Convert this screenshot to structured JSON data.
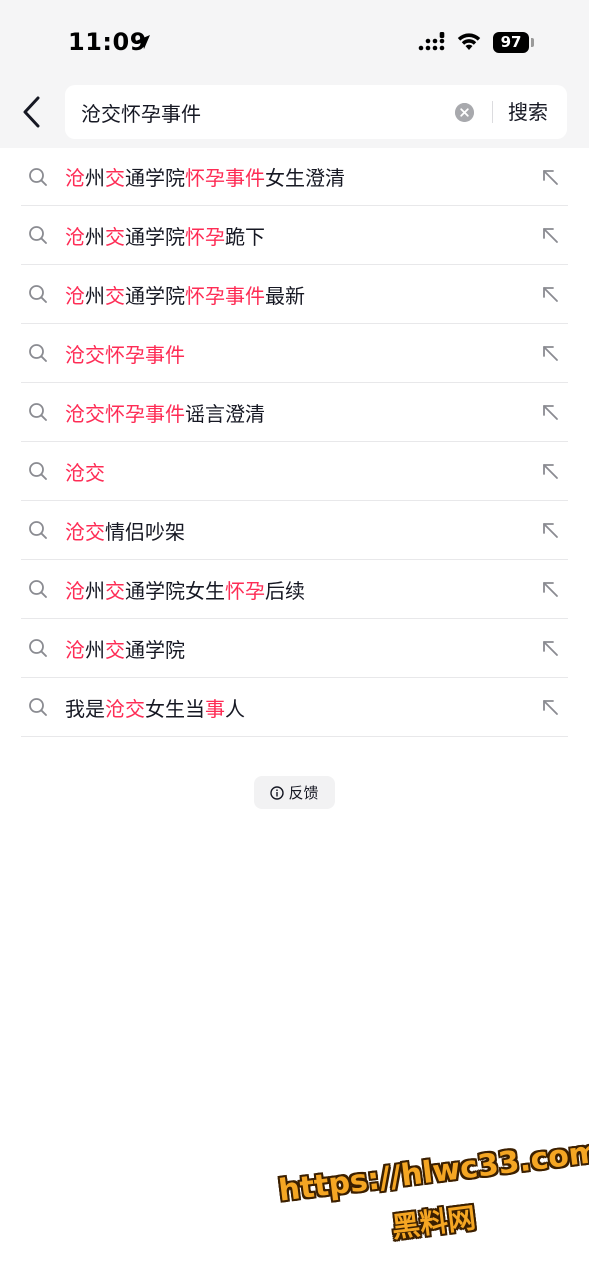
{
  "status_bar": {
    "time": "11:09",
    "battery": "97",
    "location_icon": "location-arrow-icon",
    "signal_icon": "cellular-signal-icon",
    "wifi_icon": "wifi-icon"
  },
  "search": {
    "query": "沧交怀孕事件",
    "button_label": "搜索",
    "back_icon": "chevron-left-icon",
    "clear_icon": "clear-circle-icon"
  },
  "suggestions": [
    {
      "segments": [
        {
          "t": "沧",
          "h": true
        },
        {
          "t": "州",
          "h": false
        },
        {
          "t": "交",
          "h": true
        },
        {
          "t": "通学院",
          "h": false
        },
        {
          "t": "怀孕事件",
          "h": true
        },
        {
          "t": "女生澄清",
          "h": false
        }
      ]
    },
    {
      "segments": [
        {
          "t": "沧",
          "h": true
        },
        {
          "t": "州",
          "h": false
        },
        {
          "t": "交",
          "h": true
        },
        {
          "t": "通学院",
          "h": false
        },
        {
          "t": "怀孕",
          "h": true
        },
        {
          "t": "跪下",
          "h": false
        }
      ]
    },
    {
      "segments": [
        {
          "t": "沧",
          "h": true
        },
        {
          "t": "州",
          "h": false
        },
        {
          "t": "交",
          "h": true
        },
        {
          "t": "通学院",
          "h": false
        },
        {
          "t": "怀孕事件",
          "h": true
        },
        {
          "t": "最新",
          "h": false
        }
      ]
    },
    {
      "segments": [
        {
          "t": "沧交怀孕事件",
          "h": true
        }
      ]
    },
    {
      "segments": [
        {
          "t": "沧交怀孕事件",
          "h": true
        },
        {
          "t": "谣言澄清",
          "h": false
        }
      ]
    },
    {
      "segments": [
        {
          "t": "沧交",
          "h": true
        }
      ]
    },
    {
      "segments": [
        {
          "t": "沧交",
          "h": true
        },
        {
          "t": "情侣吵架",
          "h": false
        }
      ]
    },
    {
      "segments": [
        {
          "t": "沧",
          "h": true
        },
        {
          "t": "州",
          "h": false
        },
        {
          "t": "交",
          "h": true
        },
        {
          "t": "通学院女生",
          "h": false
        },
        {
          "t": "怀孕",
          "h": true
        },
        {
          "t": "后续",
          "h": false
        }
      ]
    },
    {
      "segments": [
        {
          "t": "沧",
          "h": true
        },
        {
          "t": "州",
          "h": false
        },
        {
          "t": "交",
          "h": true
        },
        {
          "t": "通学院",
          "h": false
        }
      ]
    },
    {
      "segments": [
        {
          "t": "我是",
          "h": false
        },
        {
          "t": "沧交",
          "h": true
        },
        {
          "t": "女生当",
          "h": false
        },
        {
          "t": "事",
          "h": true
        },
        {
          "t": "人",
          "h": false
        }
      ]
    }
  ],
  "suggestion_icons": {
    "left": "search-icon",
    "right": "fill-query-arrow-icon"
  },
  "feedback": {
    "label": "反馈",
    "icon": "info-icon"
  },
  "watermark": {
    "url": "https://hlwc33.com",
    "name": "黑料网"
  },
  "colors": {
    "highlight": "#fe2c55",
    "text": "#161823",
    "header_bg": "#f5f5f6",
    "watermark": "#f5a623"
  }
}
